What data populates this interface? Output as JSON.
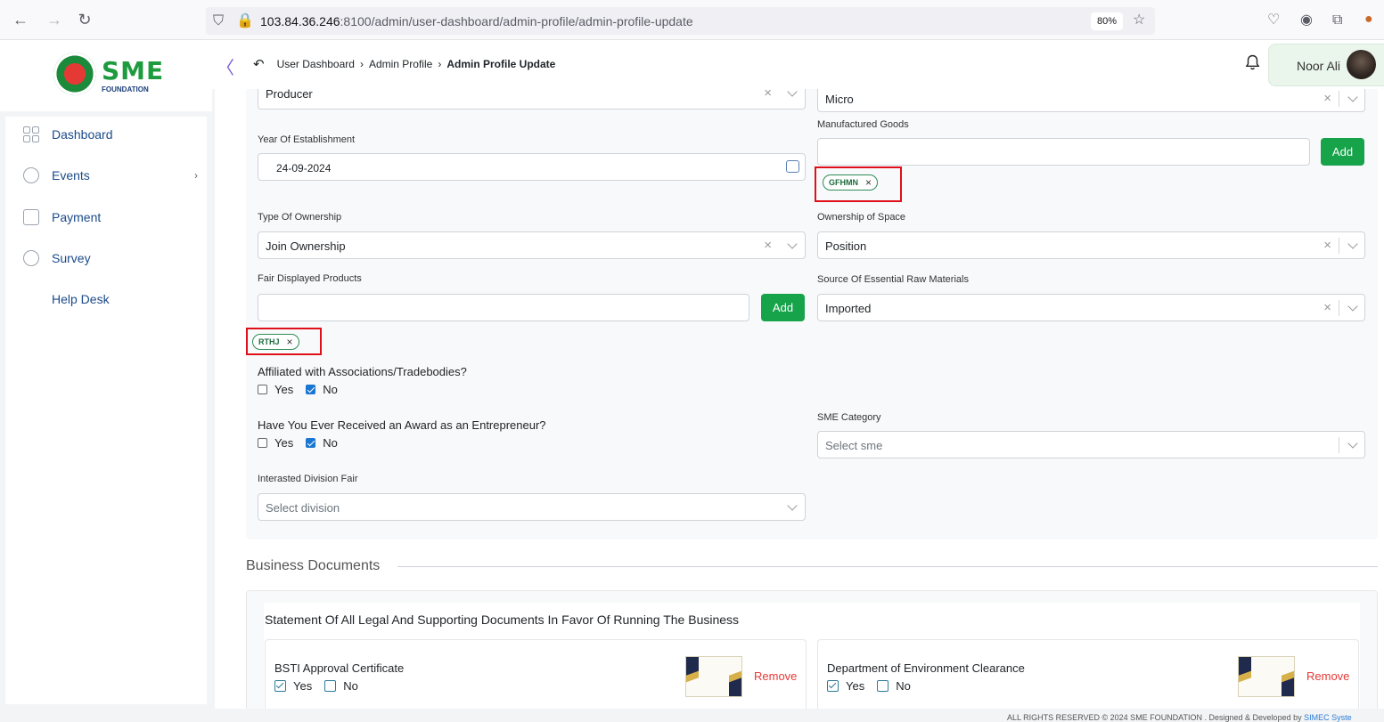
{
  "browser": {
    "url_host": "103.84.36.246",
    "url_rest": ":8100/admin/user-dashboard/admin-profile/admin-profile-update",
    "zoom": "80%"
  },
  "sidebar": {
    "logo_text": "SME",
    "logo_sub": "FOUNDATION",
    "items": [
      {
        "label": "Dashboard",
        "icon": "grid-icon"
      },
      {
        "label": "Events",
        "icon": "events-icon"
      },
      {
        "label": "Payment",
        "icon": "payment-icon"
      },
      {
        "label": "Survey",
        "icon": "survey-icon"
      },
      {
        "label": "Help Desk",
        "icon": ""
      }
    ],
    "events_chevron": "›"
  },
  "header": {
    "breadcrumb": [
      "User Dashboard",
      "Admin Profile",
      "Admin Profile Update"
    ],
    "user_name": "Noor Ali"
  },
  "form": {
    "enterprise_type": "Producer",
    "enterprise_size": "Micro",
    "year_label": "Year Of Establishment",
    "year_value": "24-09-2024",
    "manufactured_label": "Manufactured Goods",
    "manufactured_tag": "GFHMN",
    "ownership_type_label": "Type Of Ownership",
    "ownership_type_value": "Join Ownership",
    "ownership_space_label": "Ownership of Space",
    "ownership_space_value": "Position",
    "fair_products_label": "Fair Displayed Products",
    "fair_products_tag": "RTHJ",
    "raw_materials_label": "Source Of Essential Raw Materials",
    "raw_materials_value": "Imported",
    "add_label": "Add",
    "affiliated_question": "Affiliated with Associations/Tradebodies?",
    "award_question": "Have You Ever Received an Award as an Entrepreneur?",
    "yes": "Yes",
    "no": "No",
    "sme_category_label": "SME Category",
    "sme_category_placeholder": "Select sme",
    "division_label": "Interasted Division Fair",
    "division_placeholder": "Select division"
  },
  "documents": {
    "section_title": "Business Documents",
    "statement": "Statement Of All Legal And Supporting Documents In Favor Of Running The Business",
    "cards": [
      {
        "name": "BSTI Approval Certificate",
        "remove": "Remove"
      },
      {
        "name": "Department of Environment Clearance",
        "remove": "Remove"
      }
    ]
  },
  "footer": {
    "text": "ALL RIGHTS RESERVED © 2024 SME FOUNDATION . Designed & Developed by",
    "link": "SIMEC Syste"
  },
  "colors": {
    "accent_green": "#17a34a",
    "highlight_red": "#e0101a",
    "remove_red": "#e53935",
    "sidebar_text": "#1b4a8a"
  }
}
